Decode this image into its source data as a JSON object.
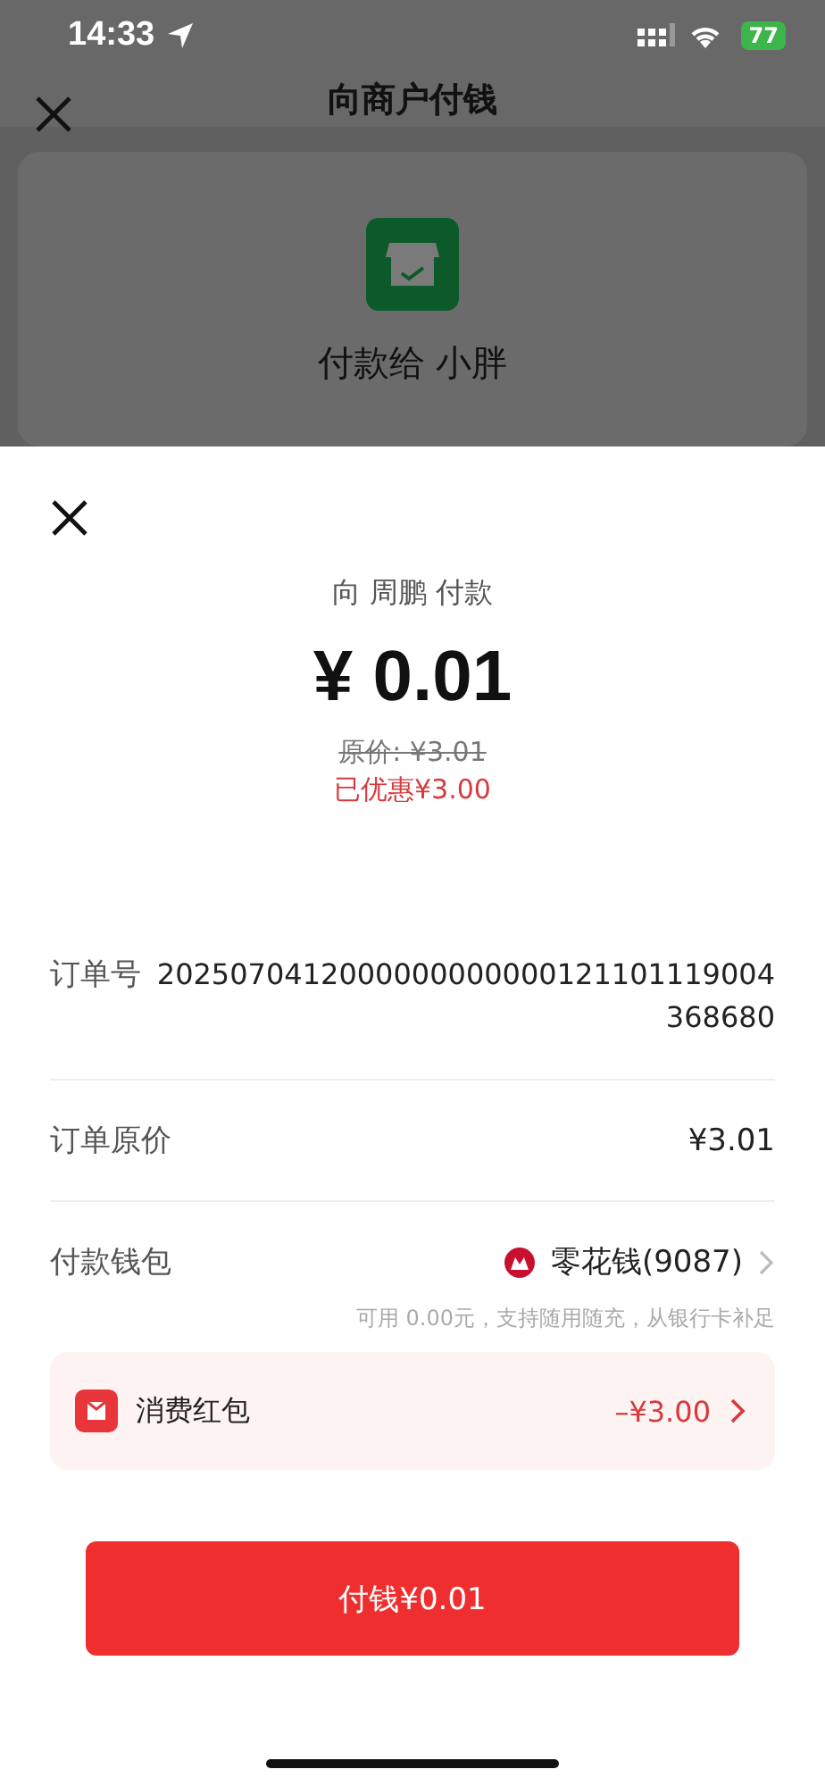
{
  "status_bar": {
    "time": "14:33",
    "battery": "77"
  },
  "background_page": {
    "title": "向商户付钱",
    "payee": "付款给 小胖"
  },
  "sheet": {
    "payee_line": "向 周鹏 付款",
    "amount": "¥ 0.01",
    "original_price": "原价: ¥3.01",
    "discount": "已优惠¥3.00",
    "rows": [
      {
        "kind": "order",
        "label": "订单号",
        "value": "2025070412000000000000121101119004368680"
      },
      {
        "kind": "price",
        "label": "订单原价",
        "value": "¥3.01"
      },
      {
        "kind": "wallet",
        "label": "付款钱包",
        "value": "零花钱(9087)",
        "note": "可用 0.00元，支持随用随充，从银行卡补足"
      }
    ],
    "coupon": {
      "label": "消费红包",
      "value": "–¥3.00"
    },
    "pay_button": "付钱¥0.01"
  }
}
